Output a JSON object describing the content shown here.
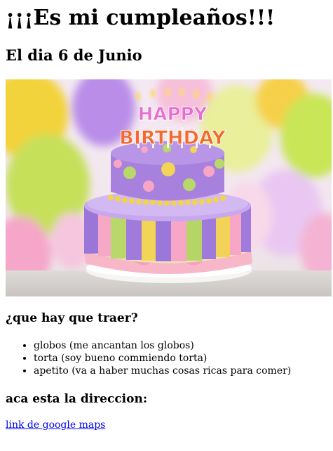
{
  "page": {
    "title": "¡¡¡Es mi cumpleaños!!!",
    "date_heading": "El dia 6 de Junio"
  },
  "image": {
    "description_icon": "birthday-cake-photo",
    "topper_line1": "HAPPY",
    "topper_line2": "BIRTHDAY"
  },
  "bring": {
    "heading": "¿que hay que traer?",
    "items": [
      "globos (me ancantan los globos)",
      "torta (soy bueno commiendo torta)",
      "apetito (va a haber muchas cosas ricas para comer)"
    ]
  },
  "address": {
    "heading": "aca esta la direccion:",
    "link_text": "link de google maps"
  },
  "colors": {
    "link": "#0000ee",
    "text": "#000000",
    "background": "#ffffff"
  }
}
